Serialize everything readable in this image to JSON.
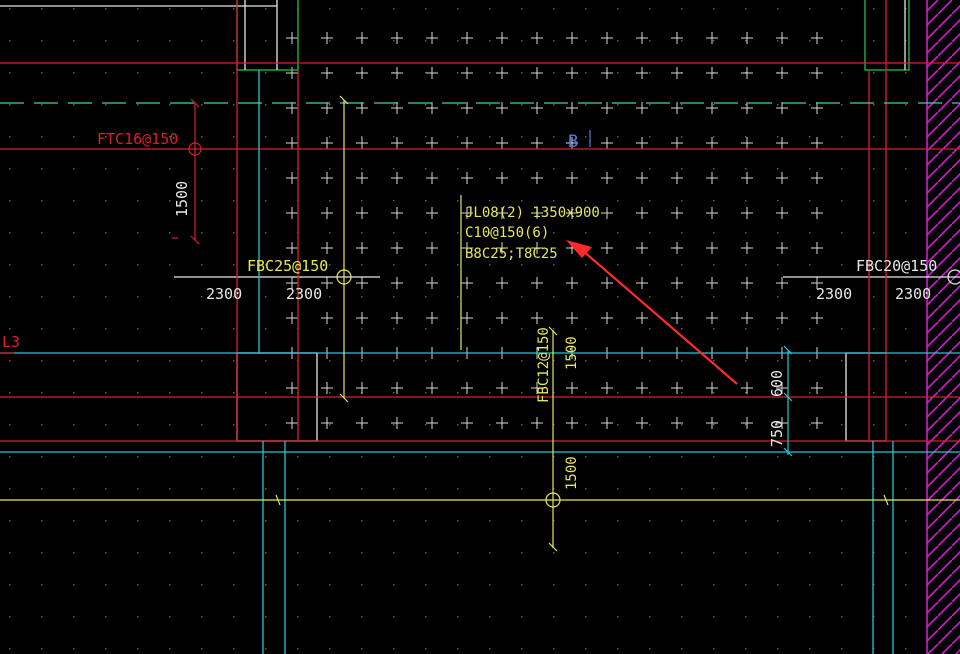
{
  "app": "CAD drawing viewport",
  "colors": {
    "background": "#000000",
    "red": "#d8202a",
    "cyan": "#23c8d2",
    "yellow": "#e6e65a",
    "white": "#e8e8e8",
    "green": "#1fc24a",
    "magenta": "#d01ed0",
    "blue_text": "#5a78e0",
    "annotation_arrow": "#ff2a2a"
  },
  "labels": {
    "ftc_rebar": "FTC16@150",
    "dim_1500_left": "1500",
    "section_b": "B",
    "beam_line1": "JL08(2) 1350x900",
    "beam_line2": "C10@150(6)",
    "beam_line3": "B8C25;T8C25",
    "fbc_left": "FBC25@150",
    "dim_2300_a": "2300",
    "dim_2300_b": "2300",
    "fbc_right": "FBC20@150",
    "dim_2300_c": "2300",
    "dim_2300_d": "2300",
    "grid_l3": "L3",
    "fbc_vertical": "FBC12@150",
    "dim_1500_v_top": "1500",
    "dim_1500_v_bottom": "1500",
    "dim_600": "600",
    "dim_750": "750"
  }
}
